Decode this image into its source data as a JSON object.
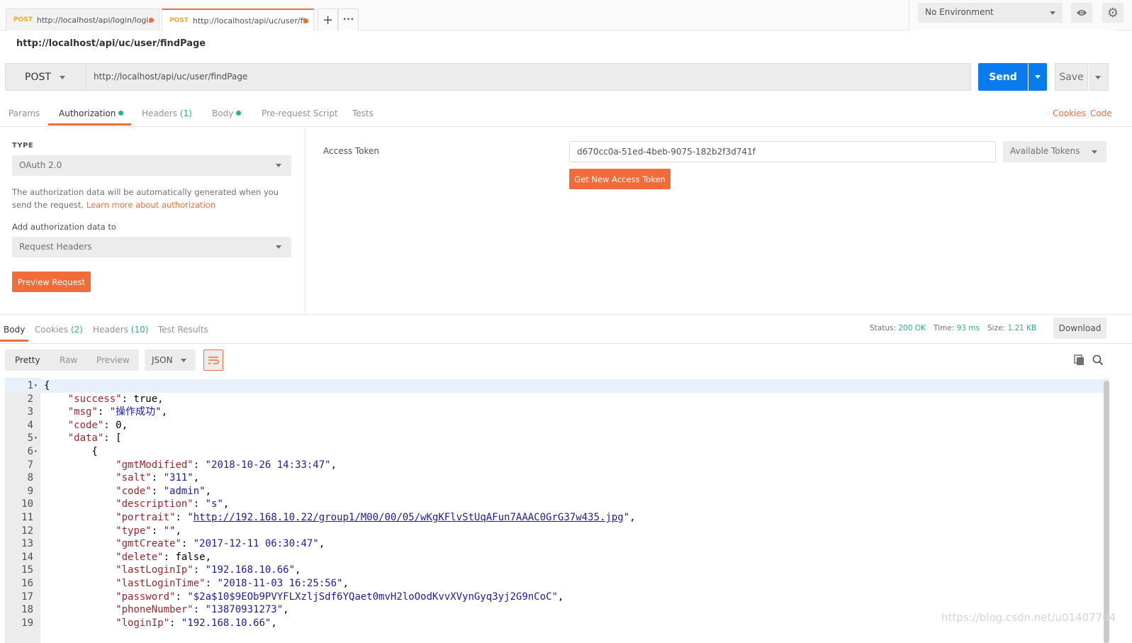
{
  "tabs": [
    {
      "method": "POST",
      "url": "http://localhost/api/login/login"
    },
    {
      "method": "POST",
      "url": "http://localhost/api/uc/user/fin"
    }
  ],
  "tab_add": "+",
  "tab_more": "•••",
  "environment": {
    "selected": "No Environment"
  },
  "request": {
    "name": "http://localhost/api/uc/user/findPage",
    "method": "POST",
    "url": "http://localhost/api/uc/user/findPage",
    "send_label": "Send",
    "save_label": "Save"
  },
  "request_tabs": {
    "params": "Params",
    "authorization": "Authorization",
    "headers": "Headers",
    "headers_count": "(1)",
    "body": "Body",
    "prerequest": "Pre-request Script",
    "tests": "Tests",
    "cookies_link": "Cookies",
    "code_link": "Code"
  },
  "auth": {
    "type_label": "TYPE",
    "type_value": "OAuth 2.0",
    "description": "The authorization data will be automatically generated when you send the request.",
    "learn_more": "Learn more about authorization",
    "add_to_label": "Add authorization data to",
    "add_to_value": "Request Headers",
    "preview_button": "Preview Request",
    "access_token_label": "Access Token",
    "access_token_value": "d670cc0a-51ed-4beb-9075-182b2f3d741f",
    "available_tokens": "Available Tokens",
    "get_new_token_button": "Get New Access Token"
  },
  "response_tabs": {
    "body": "Body",
    "cookies": "Cookies",
    "cookies_count": "(2)",
    "headers": "Headers",
    "headers_count": "(10)",
    "test_results": "Test Results"
  },
  "response_meta": {
    "status_label": "Status:",
    "status_value": "200 OK",
    "time_label": "Time:",
    "time_value": "93 ms",
    "size_label": "Size:",
    "size_value": "1.21 KB",
    "download": "Download"
  },
  "view": {
    "pretty": "Pretty",
    "raw": "Raw",
    "preview": "Preview",
    "format": "JSON"
  },
  "code_lines": [
    "{",
    "    \"success\": true,",
    "    \"msg\": \"操作成功\",",
    "    \"code\": 0,",
    "    \"data\": [",
    "        {",
    "            \"gmtModified\": \"2018-10-26 14:33:47\",",
    "            \"salt\": \"311\",",
    "            \"code\": \"admin\",",
    "            \"description\": \"s\",",
    "            \"portrait\": \"http://192.168.10.22/group1/M00/00/05/wKgKFlvStUqAFun7AAAC0GrG37w435.jpg\",",
    "            \"type\": \"\",",
    "            \"gmtCreate\": \"2017-12-11 06:30:47\",",
    "            \"delete\": false,",
    "            \"lastLoginIp\": \"192.168.10.66\",",
    "            \"lastLoginTime\": \"2018-11-03 16:25:56\",",
    "            \"password\": \"$2a$10$9EOb9PVYFLXzljSdf6YQaet0mvH2loOodKvvXVynGyq3yj2G9nCoC\",",
    "            \"phoneNumber\": \"13870931273\",",
    "            \"loginIp\": \"192.168.10.66\","
  ],
  "watermark": "https://blog.csdn.net/u01407704",
  "colors": {
    "accent": "#f26b3a",
    "send": "#097bed",
    "success": "#26b47f"
  }
}
